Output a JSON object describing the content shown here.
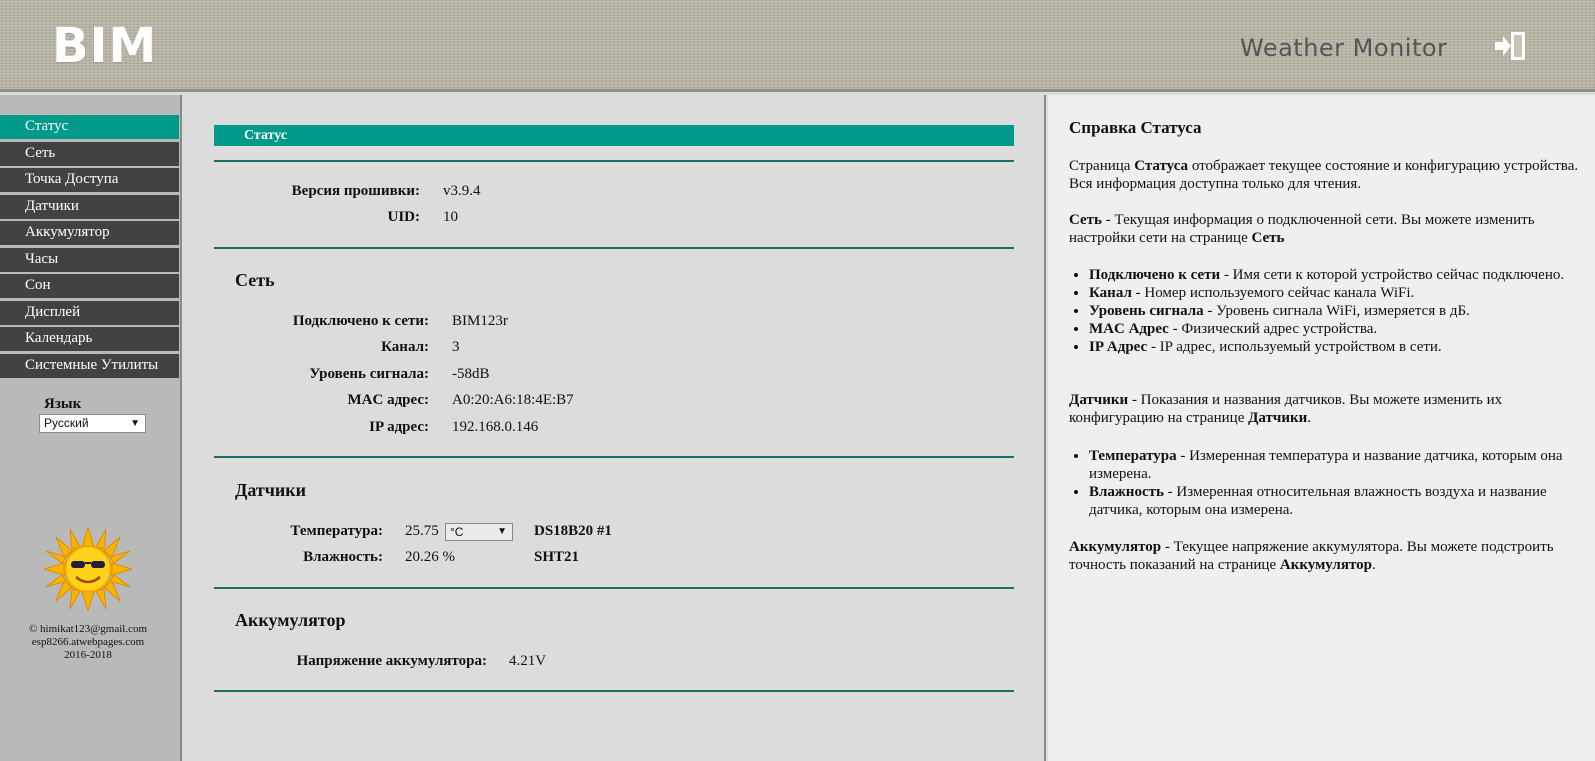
{
  "header": {
    "logo": "BIM",
    "app_title": "Weather Monitor"
  },
  "sidebar": {
    "items": [
      {
        "label": "Статус",
        "active": true
      },
      {
        "label": "Сеть"
      },
      {
        "label": "Точка Доступа"
      },
      {
        "label": "Датчики"
      },
      {
        "label": "Аккумулятор"
      },
      {
        "label": "Часы"
      },
      {
        "label": "Сон"
      },
      {
        "label": "Дисплей"
      },
      {
        "label": "Календарь"
      },
      {
        "label": "Системные Утилиты"
      }
    ],
    "language_label": "Язык",
    "language_value": "Русский",
    "copyright_lines": [
      "© himikat123@gmail.com",
      "esp8266.atwebpages.com",
      "2016-2018"
    ]
  },
  "main": {
    "header": "Статус",
    "firmware_label": "Версия прошивки:",
    "firmware_value": "v3.9.4",
    "uid_label": "UID:",
    "uid_value": "10",
    "network": {
      "title": "Сеть",
      "connected_label": "Подключено к сети:",
      "connected_value": "BIM123r",
      "channel_label": "Канал:",
      "channel_value": "3",
      "signal_label": "Уровень сигнала:",
      "signal_value": "-58dB",
      "mac_label": "MAC адрес:",
      "mac_value": "A0:20:A6:18:4E:B7",
      "ip_label": "IP адрес:",
      "ip_value": "192.168.0.146"
    },
    "sensors": {
      "title": "Датчики",
      "temp_label": "Температура:",
      "temp_value": "25.75",
      "temp_unit": "°C",
      "temp_sensor": "DS18B20 #1",
      "hum_label": "Влажность:",
      "hum_value": "20.26 %",
      "hum_sensor": "SHT21"
    },
    "battery": {
      "title": "Аккумулятор",
      "voltage_label": "Напряжение аккумулятора:",
      "voltage_value": "4.21V"
    }
  },
  "help": {
    "title": "Справка Статуса",
    "intro_a": "Страница ",
    "intro_b": "Статуса",
    "intro_c": " отображает текущее состояние и конфигурацию устройства. Вся информация доступна только для чтения.",
    "net_a": "Сеть",
    "net_b": " - Текущая информация о подключенной сети. Вы можете изменить настройки сети на странице ",
    "net_c": "Сеть",
    "net_items": [
      {
        "term": "Подключено к сети",
        "desc": " - Имя сети к которой устройство сейчас подключено."
      },
      {
        "term": "Канал",
        "desc": " - Номер используемого сейчас канала WiFi."
      },
      {
        "term": "Уровень сигнала",
        "desc": " - Уровень сигнала WiFi, измеряется в дБ."
      },
      {
        "term": "MAC Адрес",
        "desc": " - Физический адрес устройства."
      },
      {
        "term": "IP Адрес",
        "desc": " - IP адрес, используемый устройством в сети."
      }
    ],
    "sens_a": "Датчики",
    "sens_b": " - Показания и названия датчиков. Вы можете изменить их конфигурацию на странице ",
    "sens_c": "Датчики",
    "sens_d": ".",
    "sens_items": [
      {
        "term": "Температура",
        "desc": " - Измеренная температура и название датчика, которым она измерена."
      },
      {
        "term": "Влажность",
        "desc": " - Измеренная относительная влажность воздуха и название датчика, которым она измерена."
      }
    ],
    "bat_a": "Аккумулятор",
    "bat_b": " - Текущее напряжение аккумулятора. Вы можете подстроить точность показаний на странице ",
    "bat_c": "Аккумулятор",
    "bat_d": "."
  },
  "colors": {
    "accent": "#009a8a",
    "menu_bg": "#424242",
    "divider": "#1b6e64"
  }
}
